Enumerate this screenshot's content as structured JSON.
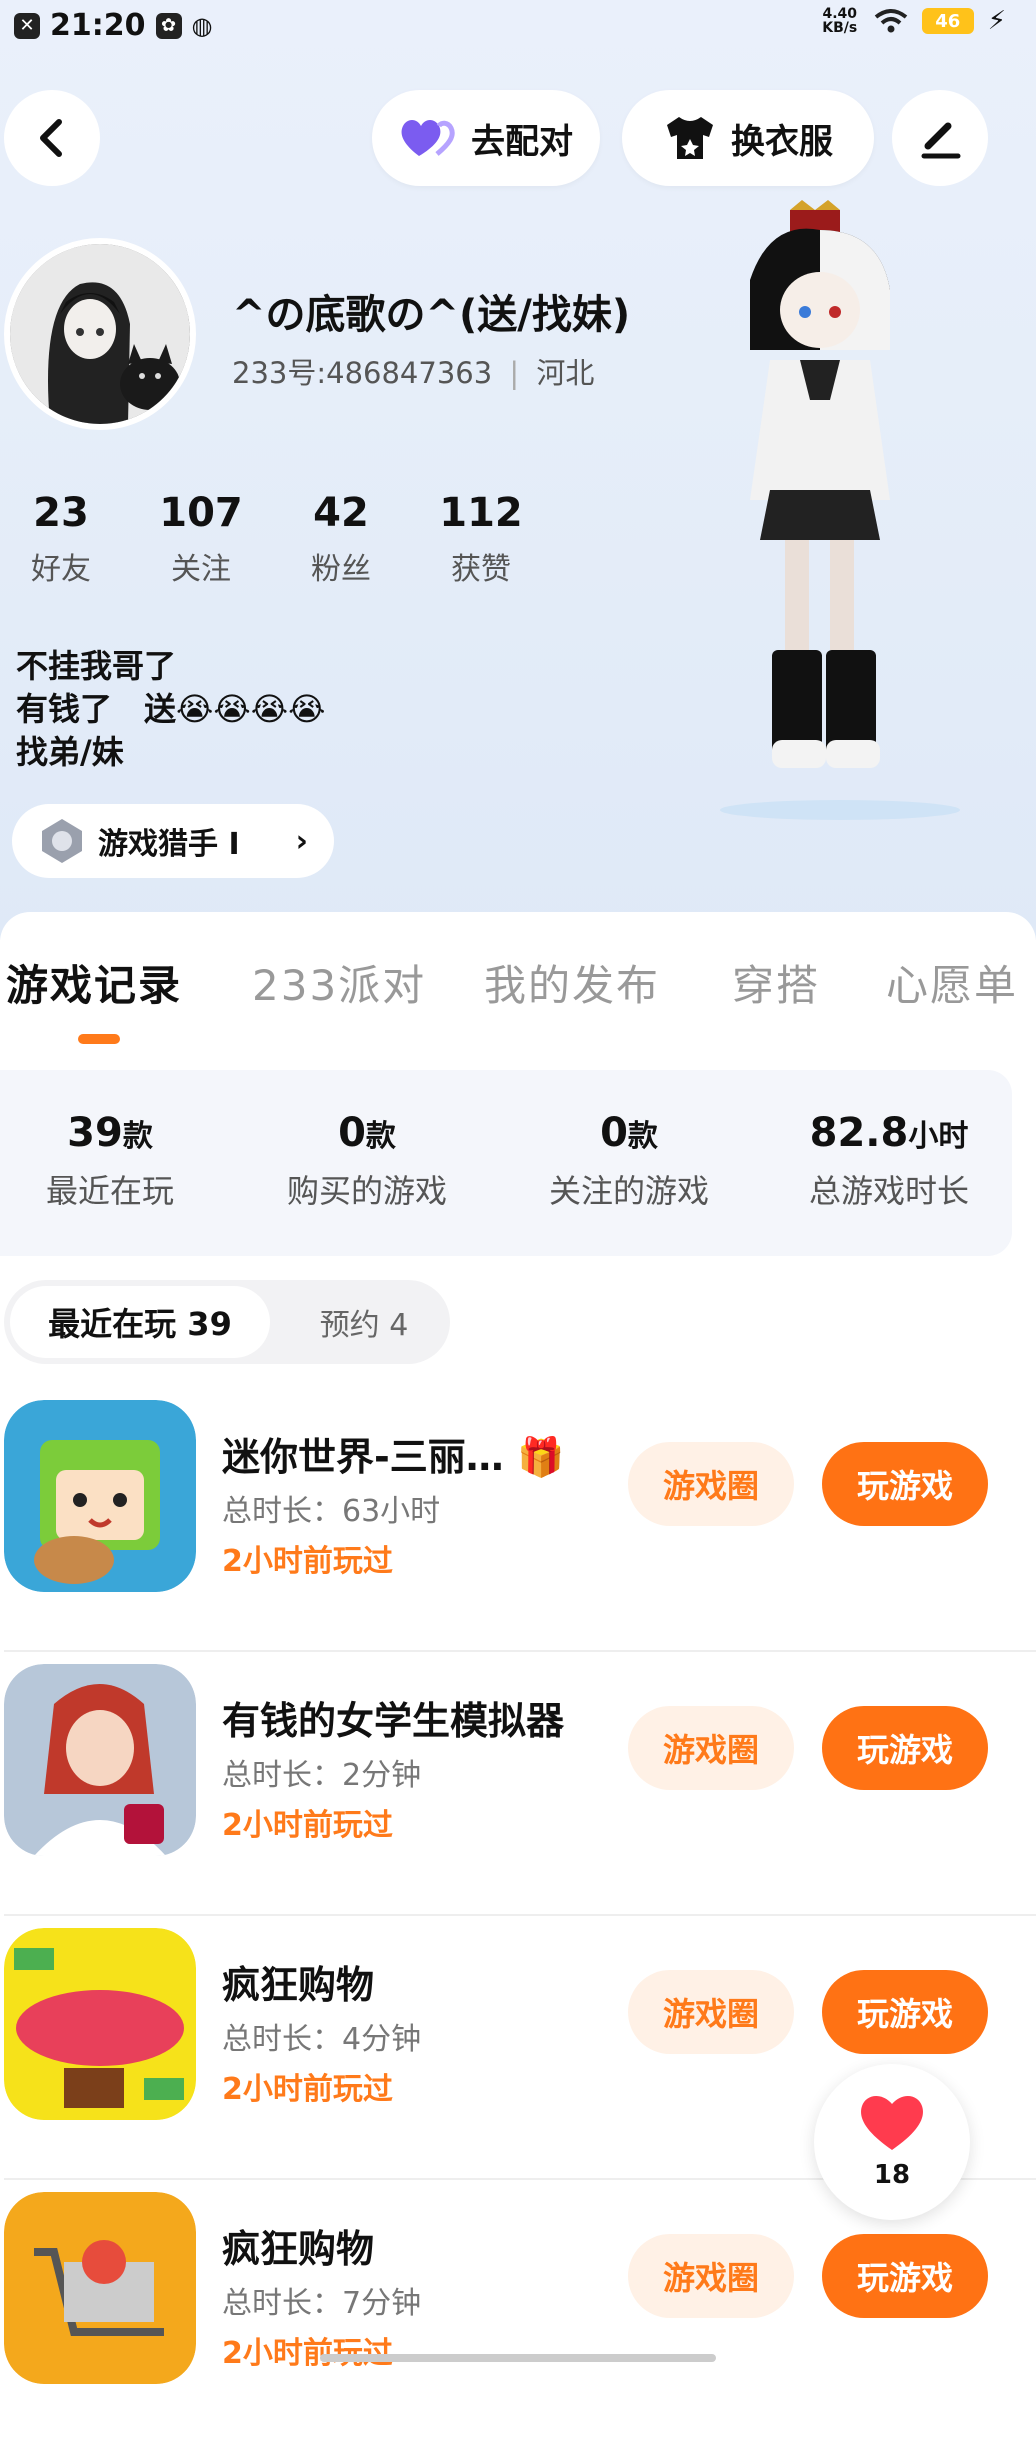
{
  "status": {
    "time": "21:20",
    "net_speed": "4.40 KB/s",
    "battery": "46"
  },
  "header": {
    "match_label": "去配对",
    "outfit_label": "换衣服"
  },
  "profile": {
    "name": "^の底歌の^(送/找妹)",
    "uid": "233号:486847363",
    "location": "河北",
    "badge": "游戏猎手 Ⅰ"
  },
  "stats": [
    {
      "n": "23",
      "t": "好友"
    },
    {
      "n": "107",
      "t": "关注"
    },
    {
      "n": "42",
      "t": "粉丝"
    },
    {
      "n": "112",
      "t": "获赞"
    }
  ],
  "bio": {
    "line1": "不挂我哥了",
    "line2": "有钱了　送😭😭😭😭",
    "line3": "找弟/妹"
  },
  "tabs": [
    "游戏记录",
    "233派对",
    "我的发布",
    "穿搭",
    "心愿单"
  ],
  "summary": [
    {
      "n": "39",
      "u": "款",
      "t": "最近在玩"
    },
    {
      "n": "0",
      "u": "款",
      "t": "购买的游戏"
    },
    {
      "n": "0",
      "u": "款",
      "t": "关注的游戏"
    },
    {
      "n": "82.8",
      "u": "小时",
      "t": "总游戏时长"
    }
  ],
  "segment": {
    "active": "最近在玩 39",
    "other": "预约 4"
  },
  "games": [
    {
      "title": "迷你世界-三丽…",
      "dur": "总时长：63小时",
      "ago": "2小时前玩过"
    },
    {
      "title": "有钱的女学生模拟器",
      "dur": "总时长：2分钟",
      "ago": "2小时前玩过"
    },
    {
      "title": "疯狂购物",
      "dur": "总时长：4分钟",
      "ago": "2小时前玩过"
    },
    {
      "title": "疯狂购物",
      "dur": "总时长：7分钟",
      "ago": "2小时前玩过"
    }
  ],
  "buttons": {
    "circle": "游戏圈",
    "play": "玩游戏"
  },
  "fab": {
    "count": "18"
  },
  "icons": [
    "back-icon",
    "heart-pair-icon",
    "tshirt-icon",
    "edit-icon",
    "gift-icon",
    "heart-icon",
    "wifi-icon",
    "battery-icon"
  ]
}
